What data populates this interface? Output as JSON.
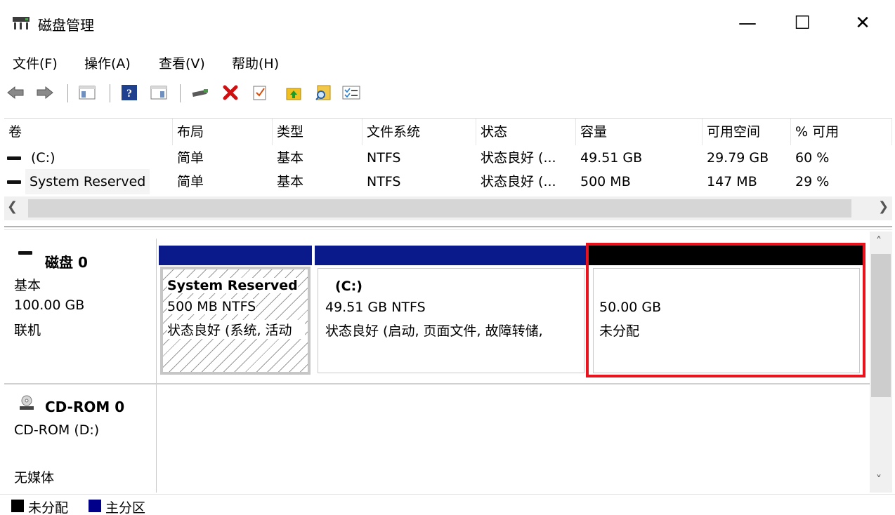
{
  "window": {
    "title": "磁盘管理",
    "minimize_glyph": "—",
    "maximize_glyph": "☐",
    "close_glyph": "✕"
  },
  "menu": [
    "文件(F)",
    "操作(A)",
    "查看(V)",
    "帮助(H)"
  ],
  "toolbar": {
    "icons": [
      "back-icon",
      "forward-icon",
      "console-tree-icon",
      "help-icon",
      "action-pane-icon",
      "connect-drive-icon",
      "delete-icon",
      "check-icon",
      "up-folder-icon",
      "search-icon",
      "properties-icon"
    ]
  },
  "table": {
    "columns": [
      "卷",
      "布局",
      "类型",
      "文件系统",
      "状态",
      "容量",
      "可用空间",
      "% 可用"
    ],
    "rows": [
      {
        "volume": "(C:)",
        "layout": "简单",
        "type": "基本",
        "fs": "NTFS",
        "status": "状态良好 (...",
        "capacity": "49.51 GB",
        "free": "29.79 GB",
        "pct": "60 %"
      },
      {
        "volume": "System Reserved",
        "layout": "简单",
        "type": "基本",
        "fs": "NTFS",
        "status": "状态良好 (...",
        "capacity": "500 MB",
        "free": "147 MB",
        "pct": "29 %"
      }
    ]
  },
  "disks": [
    {
      "title": "磁盘 0",
      "lines": [
        "基本",
        "100.00 GB",
        "联机"
      ],
      "partitions": [
        {
          "name": "System Reserved",
          "size": "500 MB NTFS",
          "status": "状态良好 (系统, 活动",
          "kind": "primary"
        },
        {
          "name": "(C:)",
          "size": "49.51 GB NTFS",
          "status": "状态良好 (启动, 页面文件, 故障转储,",
          "kind": "primary"
        },
        {
          "name": "",
          "size": "50.00 GB",
          "status": "未分配",
          "kind": "unallocated"
        }
      ]
    },
    {
      "title": "CD-ROM 0",
      "lines": [
        "CD-ROM (D:)",
        "",
        "无媒体"
      ]
    }
  ],
  "legend": [
    {
      "label": "未分配",
      "color": "#000000"
    },
    {
      "label": "主分区",
      "color": "#00008b"
    }
  ],
  "colors": {
    "primary_bar": "#0a1a8a",
    "unallocated_bar": "#000000",
    "selection_outline": "#e8131c"
  }
}
